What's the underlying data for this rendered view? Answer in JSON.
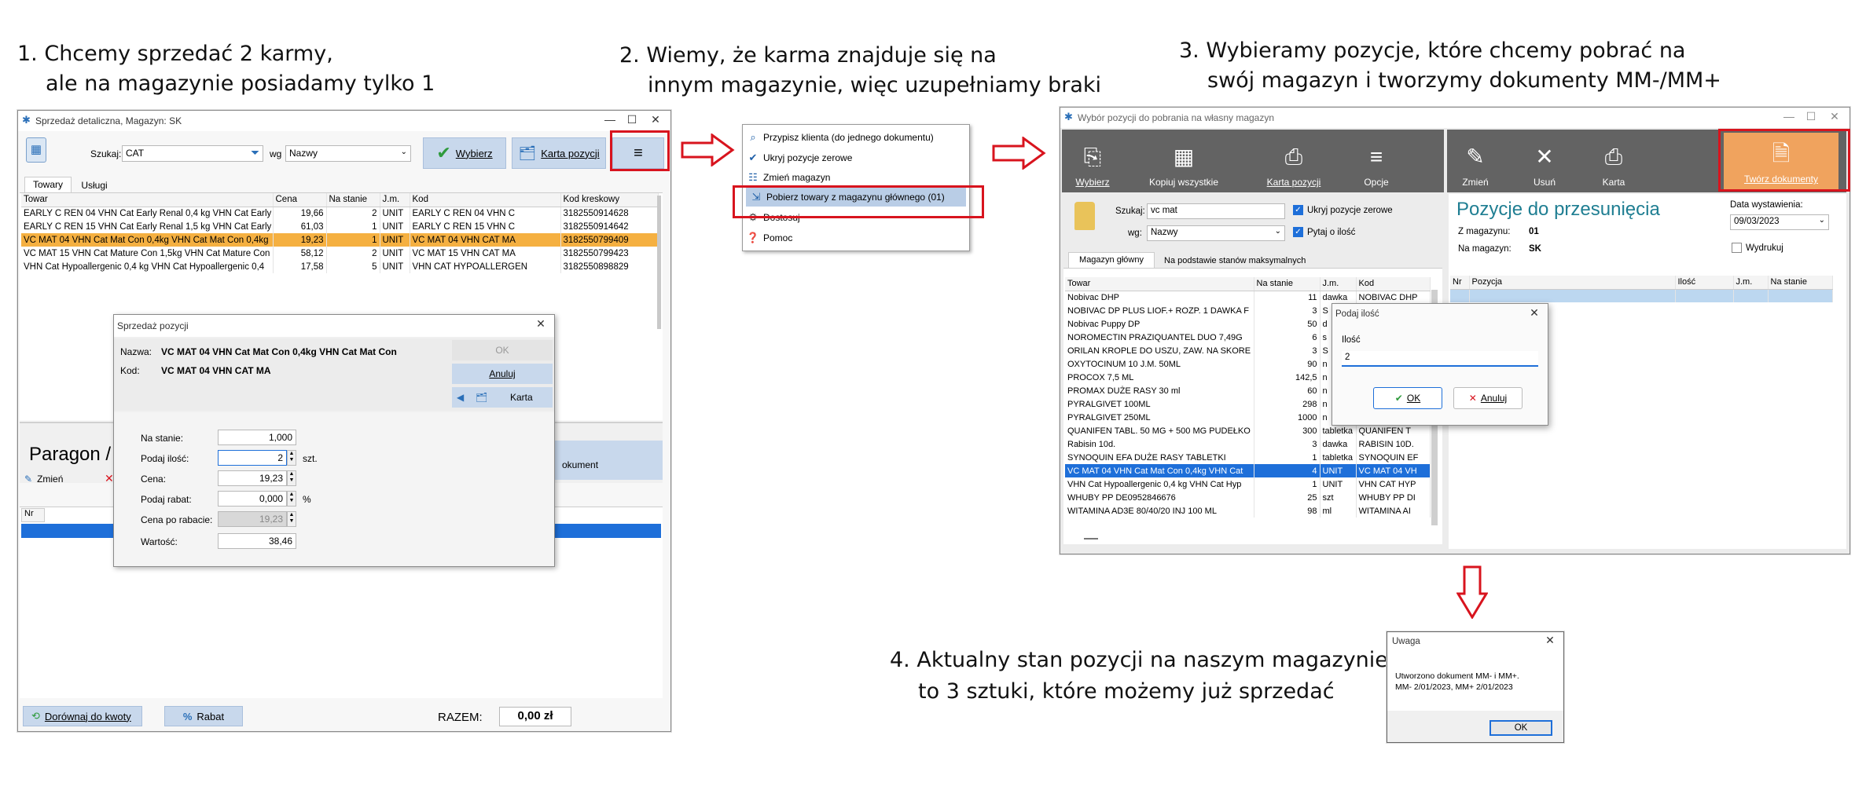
{
  "steps": {
    "s1_line1": "1.  Chcemy sprzedać 2 karmy,",
    "s1_line2": "ale na magazynie posiadamy tylko 1",
    "s2_line1": "2.  Wiemy, że karma znajduje się na",
    "s2_line2": "innym magazynie, więc uzupełniamy braki",
    "s3_line1": "3.  Wybieramy pozycje, które chcemy pobrać na",
    "s3_line2": "swój magazyn i tworzymy dokumenty MM-/MM+",
    "s4_line1": "4.  Aktualny stan pozycji na naszym magazynie",
    "s4_line2": "to 3 sztuki, które możemy już sprzedać"
  },
  "win1": {
    "title": "Sprzedaż detaliczna, Magazyn: SK",
    "search_label": "Szukaj:",
    "search_value": "CAT",
    "wg_label": "wg",
    "wg_value": "Nazwy",
    "btn_select": "Wybierz",
    "btn_card": "Karta pozycji",
    "menu_icon": "hamburger-icon",
    "tabs": [
      "Towary",
      "Usługi"
    ],
    "columns": [
      "Towar",
      "Cena",
      "Na stanie",
      "J.m.",
      "Kod",
      "Kod kreskowy"
    ],
    "rows": [
      [
        "EARLY C REN 04 VHN Cat Early Renal 0,4 kg VHN Cat Early Re",
        "19,66",
        "2",
        "UNIT",
        "EARLY C REN 04 VHN C",
        "3182550914628"
      ],
      [
        "EARLY C REN 15 VHN Cat Early Renal 1,5 kg VHN Cat Early Re",
        "61,03",
        "1",
        "UNIT",
        "EARLY C REN 15 VHN C",
        "3182550914642"
      ],
      [
        "VC MAT 04 VHN Cat Mat Con 0,4kg VHN Cat Mat Con 0,4kg",
        "19,23",
        "1",
        "UNIT",
        "VC MAT 04 VHN CAT MA",
        "3182550799409"
      ],
      [
        "VC MAT 15 VHN Cat Mature Con 1,5kg VHN Cat Mature Con",
        "58,12",
        "2",
        "UNIT",
        "VC MAT 15 VHN CAT MA",
        "3182550799423"
      ],
      [
        "VHN Cat Hypoallergenic 0,4 kg VHN Cat Hypoallergenic 0,4",
        "17,58",
        "5",
        "UNIT",
        "VHN CAT HYPOALLERGEN",
        "3182550898829"
      ]
    ],
    "paragon_label": "Paragon /",
    "btn_change": "Zmień",
    "btn_document_partial": "okument",
    "nr_col": "Nr",
    "btn_round": "Dorównaj do kwoty",
    "btn_discount": "Rabat",
    "total_label": "RAZEM:",
    "total_value": "0,00 zł"
  },
  "dialog_sale": {
    "title": "Sprzedaż pozycji",
    "name_label": "Nazwa:",
    "name_value": "VC MAT 04 VHN Cat Mat Con 0,4kg VHN Cat Mat Con",
    "code_label": "Kod:",
    "code_value": "VC MAT 04 VHN CAT MA",
    "btn_ok": "OK",
    "btn_cancel": "Anuluj",
    "btn_card": "Karta",
    "stock_label": "Na stanie:",
    "stock_value": "1,000",
    "qty_label": "Podaj ilość:",
    "qty_value": "2",
    "qty_unit": "szt.",
    "price_label": "Cena:",
    "price_value": "19,23",
    "discount_label": "Podaj rabat:",
    "discount_value": "0,000",
    "discount_unit": "%",
    "after_discount_label": "Cena po rabacie:",
    "after_discount_value": "19,23",
    "value_label": "Wartość:",
    "value_value": "38,46"
  },
  "menu": {
    "items": [
      "Przypisz klienta (do jednego dokumentu)",
      "Ukryj pozycje zerowe",
      "Zmień magazyn",
      "Pobierz towary z magazynu głównego (01)",
      "Dostosuj",
      "Pomoc"
    ]
  },
  "win3": {
    "title": "Wybór pozycji do pobrania na własny magazyn",
    "toolbar_left": [
      "Wybierz",
      "Kopiuj wszystkie",
      "Karta pozycji",
      "Opcje"
    ],
    "toolbar_right": [
      "Zmień",
      "Usuń",
      "Karta"
    ],
    "btn_create": "Twórz dokumenty",
    "search_label": "Szukaj:",
    "search_value": "vc mat",
    "wg_label": "wg:",
    "wg_value": "Nazwy",
    "chk_hide_zero": "Ukryj pozycje zerowe",
    "chk_ask_qty": "Pytaj o ilość",
    "tabs": [
      "Magazyn główny",
      "Na podstawie stanów maksymalnych"
    ],
    "columns": [
      "Towar",
      "Na stanie",
      "J.m.",
      "Kod"
    ],
    "rows": [
      [
        "Nobivac DHP",
        "11",
        "dawka",
        "NOBIVAC DHP"
      ],
      [
        "NOBIVAC DP PLUS LIOF.+ ROZP. 1 DAWKA F",
        "3",
        "S",
        ""
      ],
      [
        "Nobivac Puppy DP",
        "50",
        "d",
        ""
      ],
      [
        "NOROMECTIN PRAZIQUANTEL DUO 7,49G",
        "6",
        "s",
        ""
      ],
      [
        "ORILAN   KROPLE DO USZU, ZAW. NA SKORE",
        "3",
        "S",
        ""
      ],
      [
        "OXYTOCINUM 10 J.M. 50ML",
        "90",
        "n",
        ""
      ],
      [
        "PROCOX 7,5 ML",
        "142,5",
        "n",
        ""
      ],
      [
        "PROMAX DUŻE RASY 30 ml",
        "60",
        "n",
        ""
      ],
      [
        "PYRALGIVET 100ML",
        "298",
        "n",
        ""
      ],
      [
        "PYRALGIVET 250ML",
        "1000",
        "n",
        ""
      ],
      [
        "QUANIFEN   TABL. 50 MG + 500 MG PUDEŁKO",
        "300",
        "tabletka",
        "QUANIFEN   T"
      ],
      [
        "Rabisin 10d.",
        "3",
        "dawka",
        "RABISIN 10D."
      ],
      [
        "SYNOQUIN EFA DUŻE RASY TABLETKI",
        "1",
        "tabletka",
        "SYNOQUIN EF"
      ],
      [
        "VC MAT 04 VHN Cat Mat Con 0,4kg VHN Cat",
        "4",
        "UNIT",
        "VC MAT 04 VH"
      ],
      [
        "VHN Cat Hypoallergenic 0,4 kg VHN Cat Hyp",
        "1",
        "UNIT",
        "VHN CAT HYP"
      ],
      [
        "WHUBY PP DE0952846676",
        "25",
        "szt",
        "WHUBY PP DI"
      ],
      [
        "WITAMINA AD3E 80/40/20 INJ 100 ML",
        "98",
        "ml",
        "WITAMINA AI"
      ]
    ],
    "panel_title": "Pozycje do przesunięcia",
    "from_label": "Z magazynu:",
    "from_value": "01",
    "to_label": "Na magazyn:",
    "to_value": "SK",
    "date_label": "Data wystawienia:",
    "date_value": "09/03/2023",
    "print_label": "Wydrukuj",
    "right_columns": [
      "Nr",
      "Pozycja",
      "Ilość",
      "J.m.",
      "Na stanie"
    ]
  },
  "dialog_qty": {
    "title": "Podaj ilość",
    "label": "Ilość",
    "value": "2",
    "btn_ok": "OK",
    "btn_cancel": "Anuluj"
  },
  "dialog_info": {
    "title": "Uwaga",
    "line1": "Utworzono dokument MM- i MM+.",
    "line2": "MM- 2/01/2023, MM+ 2/01/2023",
    "btn_ok": "OK"
  },
  "colors": {
    "highlight_red": "#d8141e",
    "selection_orange": "#f5b041",
    "selection_blue": "#1e6fd9",
    "toolbar_dark": "#636363",
    "create_button": "#f0a35e",
    "title_teal": "#1f7e92"
  }
}
